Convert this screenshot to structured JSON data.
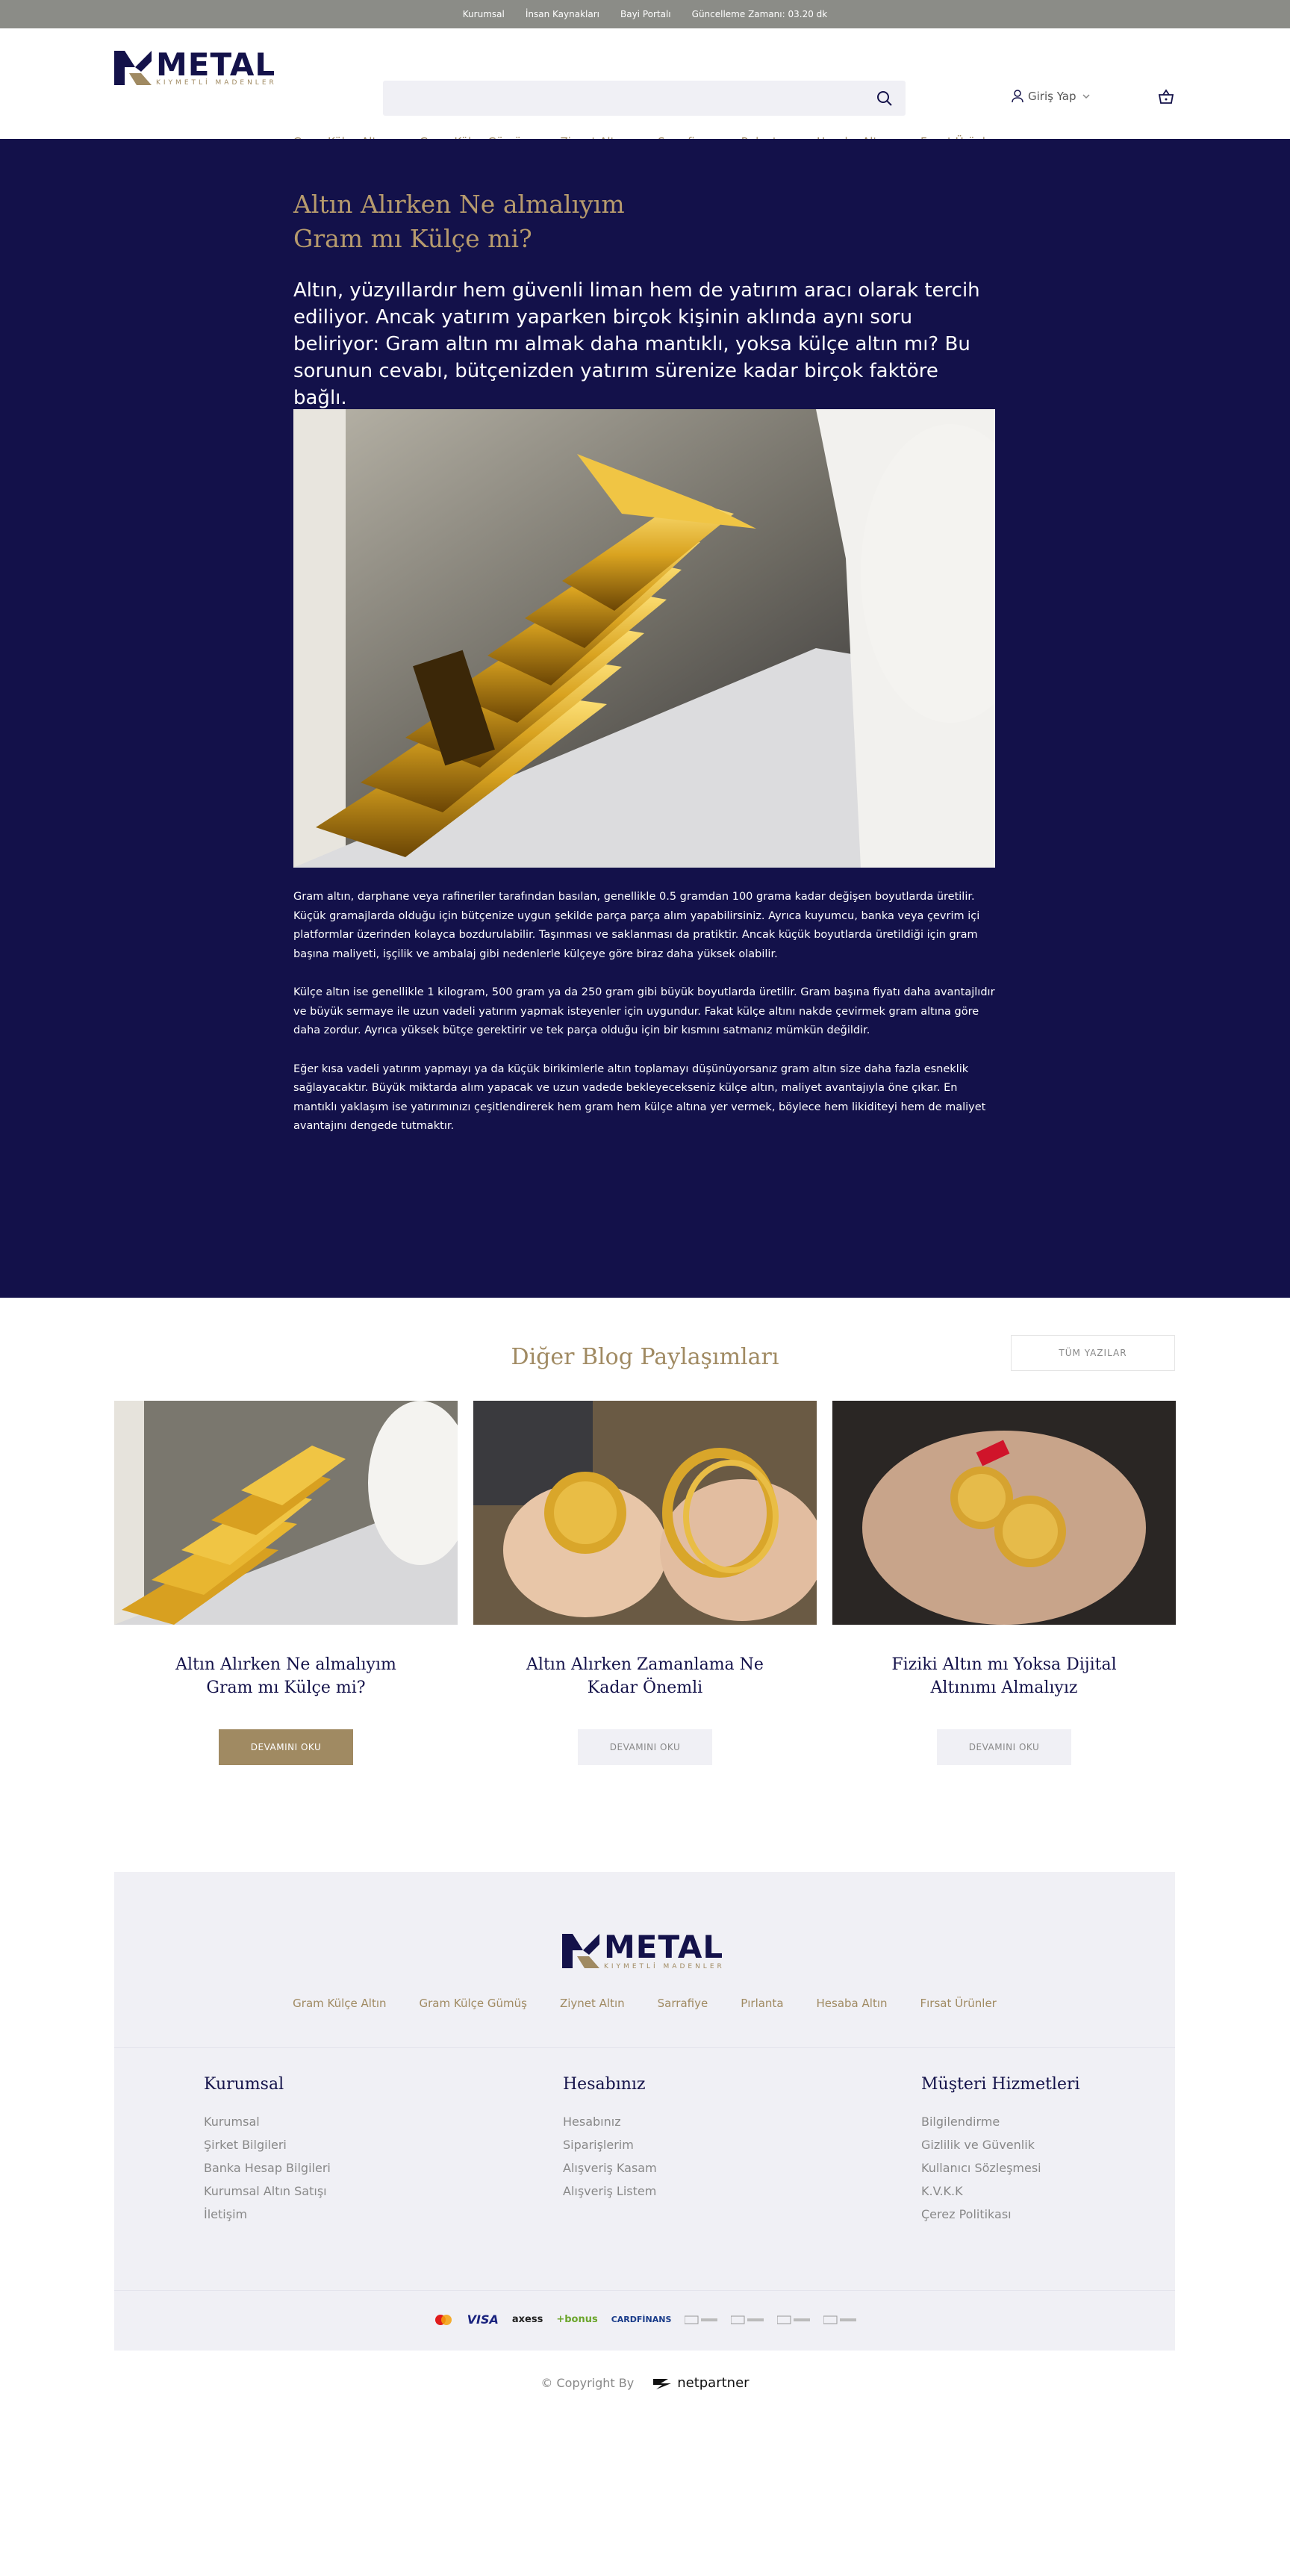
{
  "topbar": {
    "links": [
      "Kurumsal",
      "İnsan Kaynakları",
      "Bayi Portalı",
      "Güncelleme Zamanı: 03.20 dk"
    ]
  },
  "brand": {
    "name": "METAL",
    "tagline": "KIYMETLİ MADENLER",
    "primary_color": "#13114a",
    "accent_color": "#a08a62"
  },
  "header": {
    "search_placeholder": "",
    "login_label": "Giriş Yap"
  },
  "nav": {
    "items": [
      "Gram Külçe Altın",
      "Gram Külçe Gümüş",
      "Ziynet Altın",
      "Sarrafiye",
      "Pırlanta",
      "Hesaba Altın",
      "Fırsat Ürünler"
    ]
  },
  "article": {
    "title_line1": "Altın Alırken Ne almalıyım",
    "title_line2": "Gram mı Külçe mi?",
    "lead": "Altın, yüzyıllardır hem güvenli liman hem de yatırım aracı olarak tercih ediliyor. Ancak yatırım yaparken birçok kişinin aklında aynı soru beliriyor: Gram altın mı almak daha mantıklı, yoksa külçe altın mı? Bu sorunun cevabı, bütçenizden yatırım sürenize kadar birçok faktöre bağlı.",
    "paragraphs": [
      "Gram altın, darphane veya rafineriler tarafından basılan, genellikle 0.5 gramdan 100 grama kadar değişen boyutlarda üretilir. Küçük gramajlarda olduğu için bütçenize uygun şekilde parça parça alım yapabilirsiniz. Ayrıca kuyumcu, banka veya çevrim içi platformlar üzerinden kolayca bozdurulabilir. Taşınması ve saklanması da pratiktir. Ancak küçük boyutlarda üretildiği için gram başına maliyeti, işçilik ve ambalaj gibi nedenlerle külçeye göre biraz daha yüksek olabilir.",
      "Külçe altın ise genellikle 1 kilogram, 500 gram ya da 250 gram gibi büyük boyutlarda üretilir. Gram başına fiyatı daha avantajlıdır ve büyük sermaye ile uzun vadeli yatırım yapmak isteyenler için uygundur. Fakat külçe altını nakde çevirmek gram altına göre daha zordur. Ayrıca yüksek bütçe gerektirir ve tek parça olduğu için bir kısmını satmanız mümkün değildir.",
      "Eğer kısa vadeli yatırım yapmayı ya da küçük birikimlerle altın toplamayı düşünüyorsanız gram altın size daha fazla esneklik sağlayacaktır. Büyük miktarda alım yapacak ve uzun vadede bekleyecekseniz külçe altın, maliyet avantajıyla öne çıkar. En mantıklı yaklaşım ise yatırımınızı çeşitlendirerek hem gram hem külçe altına yer vermek, böylece hem likiditeyi hem de maliyet avantajını dengede tutmaktır."
    ]
  },
  "blog": {
    "heading": "Diğer Blog Paylaşımları",
    "all_posts_label": "TÜM YAZILAR",
    "cards": [
      {
        "title": "Altın Alırken Ne almalıyım Gram mı Külçe mi?",
        "button": "DEVAMINI OKU"
      },
      {
        "title": "Altın Alırken Zamanlama Ne Kadar Önemli",
        "button": "DEVAMINI OKU"
      },
      {
        "title": "Fiziki Altın mı Yoksa Dijital Altınımı Almalıyız",
        "button": "DEVAMINI OKU"
      }
    ]
  },
  "footer": {
    "nav": [
      "Gram Külçe Altın",
      "Gram Külçe Gümüş",
      "Ziynet Altın",
      "Sarrafiye",
      "Pırlanta",
      "Hesaba Altın",
      "Fırsat Ürünler"
    ],
    "columns": [
      {
        "heading": "Kurumsal",
        "links": [
          "Kurumsal",
          "Şirket Bilgileri",
          "Banka Hesap Bilgileri",
          "Kurumsal Altın Satışı",
          "İletişim"
        ]
      },
      {
        "heading": "Hesabınız",
        "links": [
          "Hesabınız",
          "Siparişlerim",
          "Alışveriş Kasam",
          "Alışveriş Listem"
        ]
      },
      {
        "heading": "Müşteri Hizmetleri",
        "links": [
          "Bilgilendirme",
          "Gizlilik ve Güvenlik",
          "Kullanıcı Sözleşmesi",
          "K.V.K.K",
          "Çerez Politikası"
        ]
      }
    ],
    "payments": [
      "VISA",
      "axess",
      "+bonus",
      "CARDFİNANS"
    ],
    "copyright": "© Copyright By",
    "partner": "netpartner"
  }
}
